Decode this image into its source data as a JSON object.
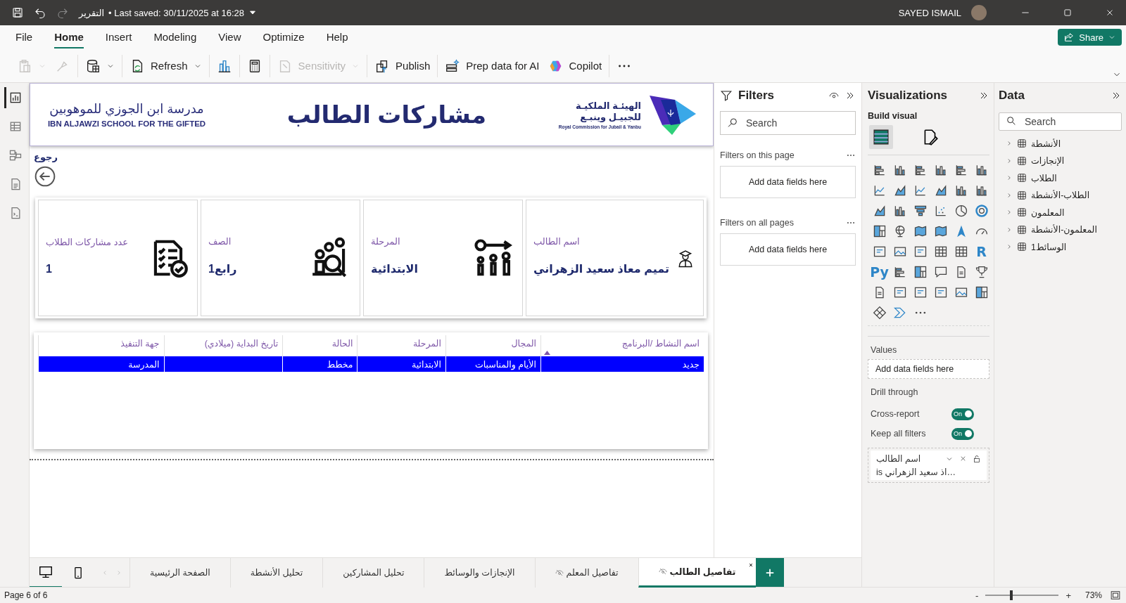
{
  "title_bar": {
    "file_name": "التقرير",
    "saved": "• Last saved: 30/11/2025 at 16:28",
    "user": "SAYED ISMAIL"
  },
  "menu_tabs": [
    {
      "label": "Help",
      "selected": false
    },
    {
      "label": "Optimize",
      "selected": false
    },
    {
      "label": "View",
      "selected": false
    },
    {
      "label": "Modeling",
      "selected": false
    },
    {
      "label": "Insert",
      "selected": false
    },
    {
      "label": "Home",
      "selected": true
    },
    {
      "label": "File",
      "selected": false
    }
  ],
  "share": "Share",
  "ribbon": [
    {
      "kind": "more",
      "disabled": false
    },
    {
      "kind": "copilot",
      "label": "Copilot",
      "disabled": false
    },
    {
      "kind": "prep",
      "label": "Prep data for AI",
      "disabled": false
    },
    {
      "kind": "publish",
      "label": "Publish",
      "disabled": false
    },
    {
      "kind": "sensitivity",
      "label": "Sensitivity",
      "disabled": true
    },
    {
      "kind": "calculator",
      "disabled": false
    },
    {
      "kind": "new-visual",
      "disabled": false
    },
    {
      "kind": "refresh",
      "label": "Refresh",
      "disabled": false
    },
    {
      "kind": "get-data",
      "disabled": false
    },
    {
      "kind": "format-painter",
      "disabled": true
    },
    {
      "kind": "paste",
      "disabled": true
    }
  ],
  "views": [
    {
      "kind": "report",
      "selected": true
    },
    {
      "kind": "table",
      "selected": false
    },
    {
      "kind": "model",
      "selected": false
    },
    {
      "kind": "dax",
      "selected": false
    },
    {
      "kind": "tmdl",
      "selected": false
    }
  ],
  "report": {
    "header": {
      "school_ar": "مدرسة ابن الجوزي للموهوبين",
      "school_en": "IBN ALJAWZI SCHOOL FOR THE GIFTED",
      "title": "مشاركات الطالب",
      "org_ar_1": "الهيئـة الملكيـة",
      "org_ar_2": "للجبيـل وينبـع",
      "org_en": "Royal Commission for Jubail & Yanbu"
    },
    "back_label": "رجوع",
    "cards": [
      {
        "kind": "student",
        "label": "اسم الطالب",
        "value": "تميم معاذ سعيد الزهراني"
      },
      {
        "kind": "stage",
        "label": "المرحلة",
        "value": "الابتدائية"
      },
      {
        "kind": "grade",
        "label": "الصف",
        "value": "رابع1"
      },
      {
        "kind": "count",
        "label": "عدد مشاركات الطلاب",
        "value": "1"
      }
    ],
    "table": {
      "columns": [
        {
          "label": "اسم النشاط /البرنامج",
          "sorted": true
        },
        {
          "label": "المجال",
          "sorted": false
        },
        {
          "label": "المرحلة",
          "sorted": false
        },
        {
          "label": "الحالة",
          "sorted": false
        },
        {
          "label": "تاريخ البداية (ميلادي)",
          "sorted": false
        },
        {
          "label": "جهة التنفيذ",
          "sorted": false
        }
      ],
      "rows": [
        {
          "cells": [
            "جديد",
            "الأيام والمناسبات",
            "الابتدائية",
            "مخطط",
            "",
            "المدرسة"
          ],
          "selected": true
        }
      ]
    }
  },
  "filters": {
    "title": "Filters",
    "search_placeholder": "Search",
    "sections": [
      {
        "title": "Filters on this page",
        "drop": "Add data fields here"
      },
      {
        "title": "Filters on all pages",
        "drop": "Add data fields here"
      }
    ]
  },
  "visualizations": {
    "title": "Visualizations",
    "build_label": "Build visual",
    "build_tabs": [
      {
        "kind": "build",
        "selected": true
      },
      {
        "kind": "format",
        "selected": false
      }
    ],
    "script_visuals": [
      "R",
      "Py"
    ],
    "values_title": "Values",
    "values_drop": "Add data fields here",
    "drill_title": "Drill through",
    "toggles": [
      {
        "label": "Cross-report",
        "on": true,
        "state": "On"
      },
      {
        "label": "Keep all filters",
        "on": true,
        "state": "On"
      }
    ],
    "drill_filter": {
      "field": "اسم الطالب",
      "value": "is اذ سعيد الزهراني…"
    }
  },
  "data": {
    "title": "Data",
    "search_placeholder": "Search",
    "tables": [
      {
        "name": "الأنشطة",
        "expanded": false
      },
      {
        "name": "الإنجازات",
        "expanded": false
      },
      {
        "name": "الطلاب",
        "expanded": false
      },
      {
        "name": "الطلاب-الأنشطة",
        "expanded": false
      },
      {
        "name": "المعلمون",
        "expanded": false
      },
      {
        "name": "المعلمون-الأنشطة",
        "expanded": false
      },
      {
        "name": "الوسائط1",
        "expanded": false
      }
    ]
  },
  "page_tabs": [
    {
      "label": "تفاصيل الطالب",
      "selected": true,
      "hidden": true
    },
    {
      "label": "تفاصيل المعلم",
      "selected": false,
      "hidden": true
    },
    {
      "label": "الإنجازات والوسائط",
      "selected": false,
      "hidden": false
    },
    {
      "label": "تحليل المشاركين",
      "selected": false,
      "hidden": false
    },
    {
      "label": "تحليل الأنشطة",
      "selected": false,
      "hidden": false
    },
    {
      "label": "الصفحة الرئيسية",
      "selected": false,
      "hidden": false
    }
  ],
  "status_bar": {
    "page": "Page 6 of 6",
    "zoom_minus": "-",
    "zoom_plus": "+",
    "zoom": {
      "level": 0.35
    },
    "zoom_text": "73%"
  }
}
